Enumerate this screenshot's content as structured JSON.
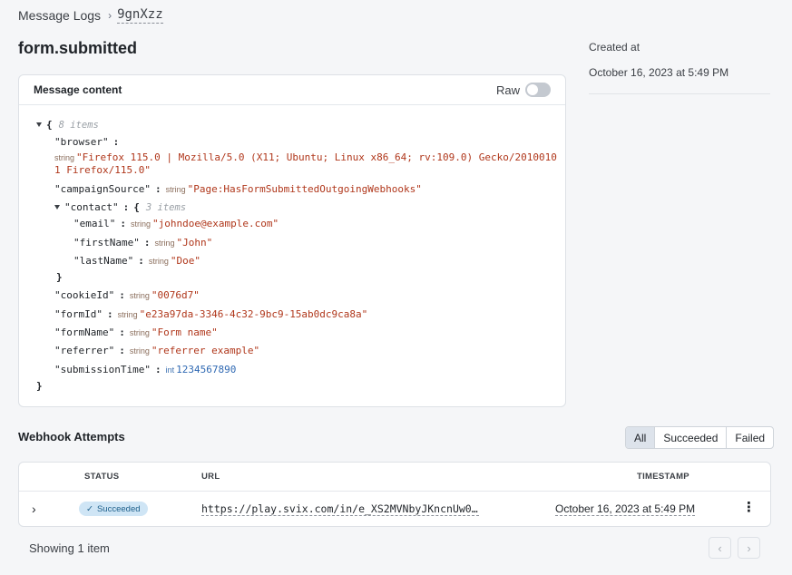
{
  "breadcrumb": {
    "parent": "Message Logs",
    "separator": "›",
    "current": "9gnXzz"
  },
  "title": "form.submitted",
  "created": {
    "label": "Created at",
    "value": "October 16, 2023 at 5:49 PM"
  },
  "message_card": {
    "title": "Message content",
    "raw_label": "Raw",
    "raw_enabled": false,
    "json": {
      "root_count": "8 items",
      "browser_key": "\"browser\"",
      "browser_type": "string",
      "browser_value_line1": "\"Firefox 115.0 | Mozilla/5.0 (X11; Ubuntu; Linux x86_64; rv:109.0) Gecko/2010010",
      "browser_value_line2": "1 Firefox/115.0\"",
      "campaignSource_key": "\"campaignSource\"",
      "campaignSource_type": "string",
      "campaignSource_value": "\"Page:HasFormSubmittedOutgoingWebhooks\"",
      "contact_key": "\"contact\"",
      "contact_count": "3 items",
      "email_key": "\"email\"",
      "email_type": "string",
      "email_value": "\"johndoe@example.com\"",
      "firstName_key": "\"firstName\"",
      "firstName_type": "string",
      "firstName_value": "\"John\"",
      "lastName_key": "\"lastName\"",
      "lastName_type": "string",
      "lastName_value": "\"Doe\"",
      "cookieId_key": "\"cookieId\"",
      "cookieId_type": "string",
      "cookieId_value": "\"0076d7\"",
      "formId_key": "\"formId\"",
      "formId_type": "string",
      "formId_value": "\"e23a97da-3346-4c32-9bc9-15ab0dc9ca8a\"",
      "formName_key": "\"formName\"",
      "formName_type": "string",
      "formName_value": "\"Form name\"",
      "referrer_key": "\"referrer\"",
      "referrer_type": "string",
      "referrer_value": "\"referrer example\"",
      "submissionTime_key": "\"submissionTime\"",
      "submissionTime_type": "int",
      "submissionTime_value": "1234567890"
    }
  },
  "webhook_attempts": {
    "title": "Webhook Attempts",
    "filters": [
      "All",
      "Succeeded",
      "Failed"
    ],
    "active_filter": "All",
    "columns": {
      "status": "STATUS",
      "url": "URL",
      "timestamp": "TIMESTAMP"
    },
    "rows": [
      {
        "status": "Succeeded",
        "url": "https://play.svix.com/in/e_XS2MVNbyJKncnUw0B…",
        "timestamp": "October 16, 2023 at 5:49 PM"
      }
    ],
    "showing": "Showing 1 item"
  },
  "colors": {
    "string_value": "#b0371b",
    "int_value": "#2f69b3",
    "badge_bg": "#cfe5f5",
    "active_filter_bg": "#dde3eb"
  }
}
